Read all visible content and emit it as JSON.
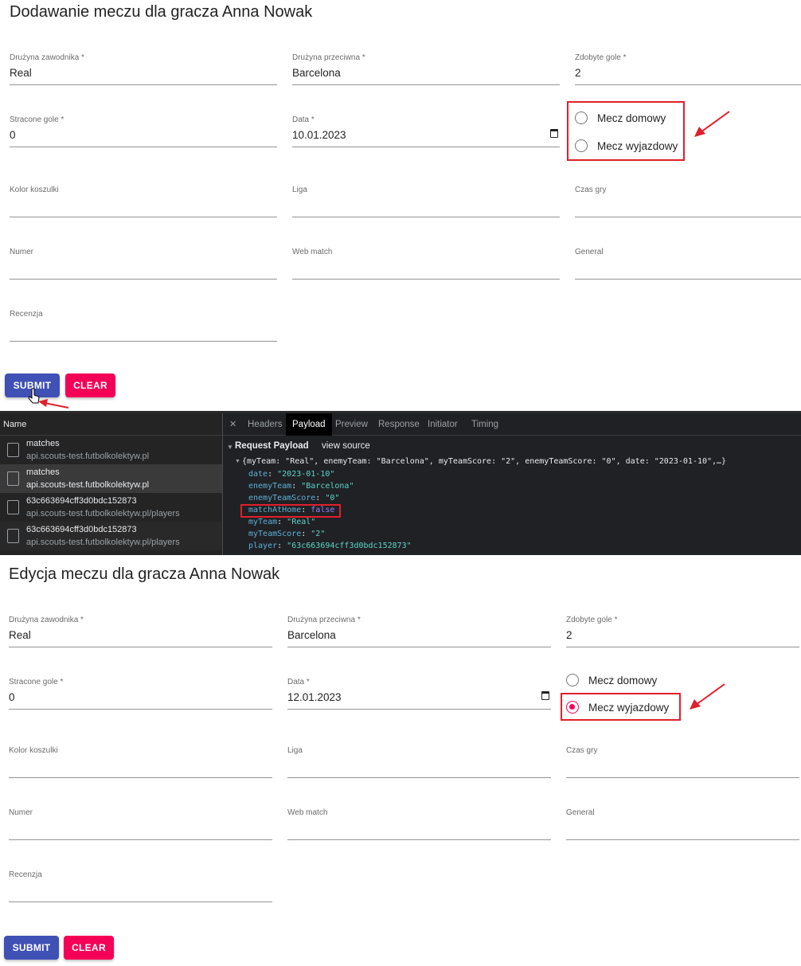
{
  "top_form": {
    "title": "Dodawanie meczu dla gracza Anna Nowak",
    "fields": [
      {
        "label": "Drużyna zawodnika *",
        "value": "Real"
      },
      {
        "label": "Drużyna przeciwna *",
        "value": "Barcelona"
      },
      {
        "label": "Zdobyte gole *",
        "value": "2"
      },
      {
        "label": "Stracone gole *",
        "value": "0"
      },
      {
        "label": "Data *",
        "value": "10.01.2023"
      },
      {
        "label": "Kolor koszulki",
        "value": ""
      },
      {
        "label": "Liga",
        "value": ""
      },
      {
        "label": "Czas gry",
        "value": ""
      },
      {
        "label": "Numer",
        "value": ""
      },
      {
        "label": "Web match",
        "value": ""
      },
      {
        "label": "General",
        "value": ""
      },
      {
        "label": "Recenzja",
        "value": ""
      }
    ],
    "radios": [
      {
        "label": "Mecz domowy",
        "checked": false
      },
      {
        "label": "Mecz wyjazdowy",
        "checked": false
      }
    ],
    "submit_label": "SUBMIT",
    "clear_label": "CLEAR"
  },
  "devtools": {
    "name_header": "Name",
    "requests": [
      {
        "name": "matches",
        "url": "api.scouts-test.futbolkolektyw.pl"
      },
      {
        "name": "matches",
        "url": "api.scouts-test.futbolkolektyw.pl"
      },
      {
        "name": "63c663694cff3d0bdc152873",
        "url": "api.scouts-test.futbolkolektyw.pl/players"
      },
      {
        "name": "63c663694cff3d0bdc152873",
        "url": "api.scouts-test.futbolkolektyw.pl/players"
      }
    ],
    "tabs": [
      "Headers",
      "Payload",
      "Preview",
      "Response",
      "Initiator",
      "Timing"
    ],
    "active_tab": "Payload",
    "payload_title": "Request Payload",
    "view_source": "view source",
    "summary": "{myTeam: \"Real\", enemyTeam: \"Barcelona\", myTeamScore: \"2\", enemyTeamScore: \"0\", date: \"2023-01-10\",…}",
    "entries": [
      {
        "key": "date",
        "value": "\"2023-01-10\"",
        "kind": "str"
      },
      {
        "key": "enemyTeam",
        "value": "\"Barcelona\"",
        "kind": "str"
      },
      {
        "key": "enemyTeamScore",
        "value": "\"0\"",
        "kind": "str"
      },
      {
        "key": "matchAtHome",
        "value": "false",
        "kind": "bool"
      },
      {
        "key": "myTeam",
        "value": "\"Real\"",
        "kind": "str"
      },
      {
        "key": "myTeamScore",
        "value": "\"2\"",
        "kind": "str"
      },
      {
        "key": "player",
        "value": "\"63c663694cff3d0bdc152873\"",
        "kind": "str"
      }
    ]
  },
  "bottom_form": {
    "title": "Edycja meczu dla gracza Anna Nowak",
    "fields": [
      {
        "label": "Drużyna zawodnika *",
        "value": "Real"
      },
      {
        "label": "Drużyna przeciwna *",
        "value": "Barcelona"
      },
      {
        "label": "Zdobyte gole *",
        "value": "2"
      },
      {
        "label": "Stracone gole *",
        "value": "0"
      },
      {
        "label": "Data *",
        "value": "12.01.2023"
      },
      {
        "label": "Kolor koszulki",
        "value": ""
      },
      {
        "label": "Liga",
        "value": ""
      },
      {
        "label": "Czas gry",
        "value": ""
      },
      {
        "label": "Numer",
        "value": ""
      },
      {
        "label": "Web match",
        "value": ""
      },
      {
        "label": "General",
        "value": ""
      },
      {
        "label": "Recenzja",
        "value": ""
      }
    ],
    "radios": [
      {
        "label": "Mecz domowy",
        "checked": false
      },
      {
        "label": "Mecz wyjazdowy",
        "checked": true
      }
    ],
    "submit_label": "SUBMIT",
    "clear_label": "CLEAR"
  },
  "colors": {
    "primary": "#3f51b5",
    "secondary": "#f50057",
    "annotation_red": "#e0202b",
    "devtools_bg": "#202124"
  },
  "icons": [
    "calendar-icon",
    "radio-icon",
    "file-icon",
    "close-icon",
    "expand-triangle-icon",
    "cursor-hand-icon",
    "annotation-arrow-icon"
  ]
}
